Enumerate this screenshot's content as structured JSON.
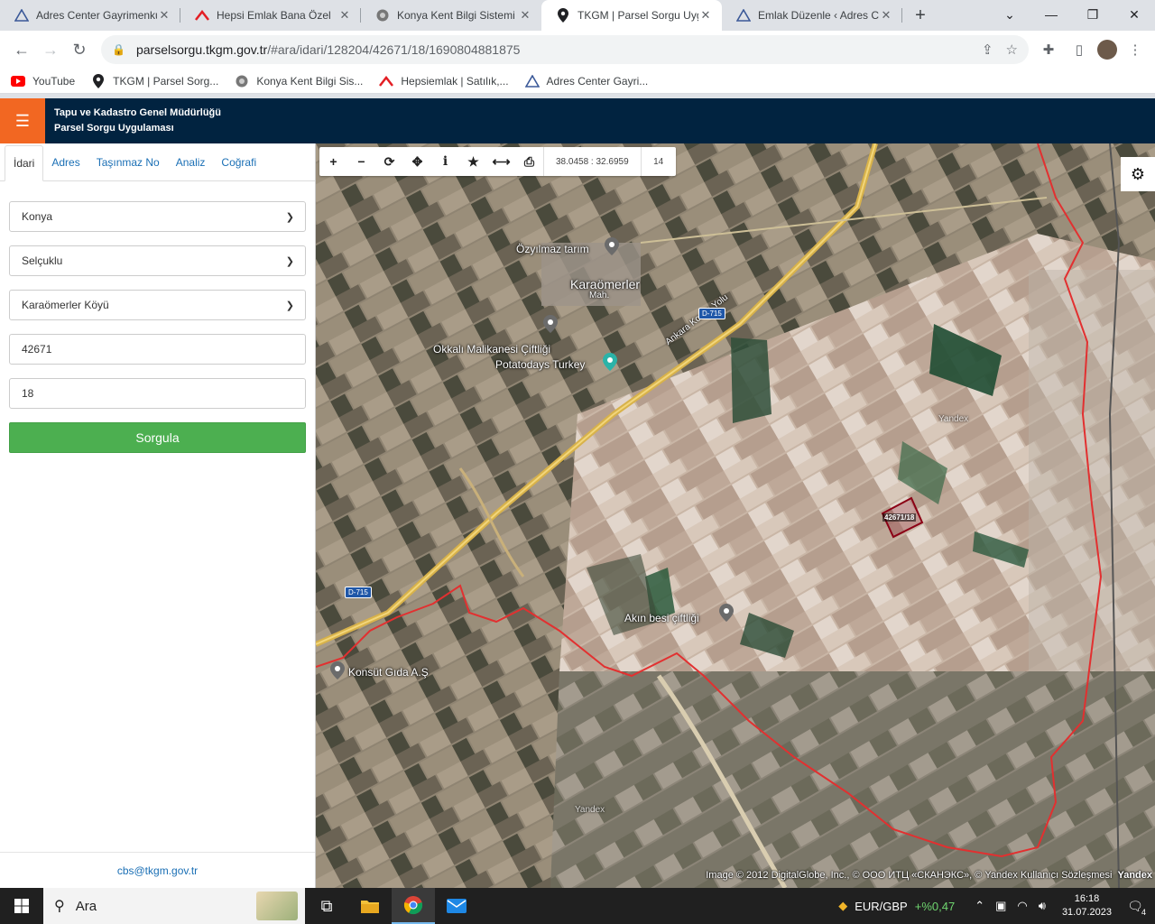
{
  "browser": {
    "tabs": [
      {
        "title": "Adres Center Gayrimenkul",
        "icon": "adres-logo-icon",
        "active": false
      },
      {
        "title": "Hepsi Emlak Bana Özel",
        "icon": "hepsiemlak-logo-icon",
        "active": false
      },
      {
        "title": "Konya Kent Bilgi Sistemi",
        "icon": "konya-logo-icon",
        "active": false
      },
      {
        "title": "TKGM | Parsel Sorgu Uygu",
        "icon": "location-pin-icon",
        "active": true
      },
      {
        "title": "Emlak Düzenle ‹ Adres Ce",
        "icon": "adres-logo-icon",
        "active": false
      }
    ],
    "url_host": "parselsorgu.tkgm.gov.tr",
    "url_path": "/#ara/idari/128204/42671/18/1690804881875",
    "bookmarks": [
      {
        "label": "YouTube",
        "icon": "youtube-icon"
      },
      {
        "label": "TKGM | Parsel Sorg...",
        "icon": "location-pin-icon"
      },
      {
        "label": "Konya Kent Bilgi Sis...",
        "icon": "konya-logo-icon"
      },
      {
        "label": "Hepsiemlak | Satılık,...",
        "icon": "hepsiemlak-logo-icon"
      },
      {
        "label": "Adres Center Gayri...",
        "icon": "adres-logo-icon"
      }
    ]
  },
  "app": {
    "title_line1": "Tapu ve Kadastro Genel Müdürlüğü",
    "title_line2": "Parsel Sorgu Uygulaması",
    "accent": "#f26722",
    "header_bg": "#012340"
  },
  "sidebar": {
    "tabs": [
      "İdari",
      "Adres",
      "Taşınmaz No",
      "Analiz",
      "Coğrafi"
    ],
    "active_tab": "İdari",
    "province": "Konya",
    "district": "Selçuklu",
    "neighborhood": "Karaömerler Köyü",
    "block": "42671",
    "parcel": "18",
    "submit_label": "Sorgula",
    "footer_email": "cbs@tkgm.gov.tr",
    "button_color": "#4caf50"
  },
  "map": {
    "coords": "38.0458 : 32.6959",
    "zoom": "14",
    "attribution": "Image © 2012 DigitalGlobe, Inc., © ООО ИТЦ «СКАНЭКС», © Yandex Kullanıcı Sözleşmesi",
    "provider": "Yandex",
    "labels": {
      "ozyilmaz": "Özyılmaz tarım",
      "karaomerler": "Karaömerler",
      "mah": "Mah.",
      "okkali": "Okkalı Malikanesi Çiftliği",
      "potatodays": "Potatodays Turkey",
      "ankara_konya": "Ankara Konya Yolu",
      "akin": "Akın besi çiftliği",
      "konsut": "Konsüt Gıda A.Ş",
      "parcel": "42671/18",
      "road": "D-715",
      "watermark1": "Yandex",
      "watermark2": "Yandex"
    }
  },
  "taskbar": {
    "search_placeholder": "Ara",
    "ticker_label": "EUR/GBP",
    "ticker_change": "+%0,47",
    "time": "16:18",
    "date": "31.07.2023",
    "notifications": "4"
  }
}
